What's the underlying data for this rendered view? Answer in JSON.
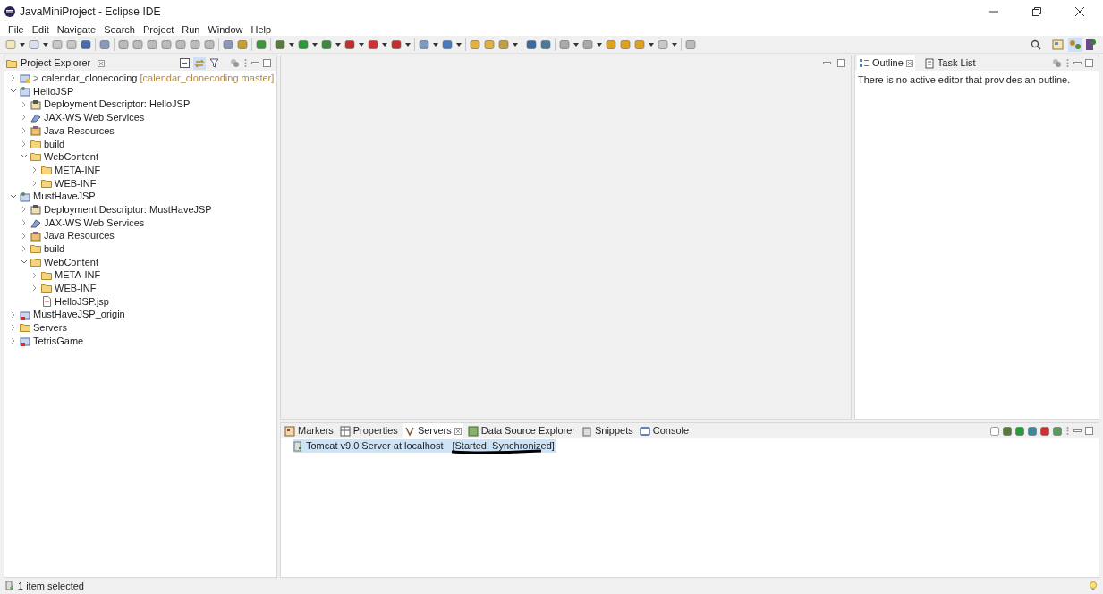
{
  "window": {
    "title": "JavaMiniProject - Eclipse IDE"
  },
  "menu": [
    "File",
    "Edit",
    "Navigate",
    "Search",
    "Project",
    "Run",
    "Window",
    "Help"
  ],
  "project_explorer": {
    "title": "Project Explorer",
    "items": [
      {
        "label": "calendar_clonecoding",
        "prefix": ">",
        "decoration": "[calendar_clonecoding master]",
        "kind": "git-project",
        "expanded": false
      },
      {
        "label": "HelloJSP",
        "kind": "web-project",
        "expanded": true,
        "children": [
          {
            "label": "Deployment Descriptor: HelloJSP",
            "kind": "descriptor",
            "expanded": false
          },
          {
            "label": "JAX-WS Web Services",
            "kind": "webservices",
            "expanded": false
          },
          {
            "label": "Java Resources",
            "kind": "resources",
            "expanded": false
          },
          {
            "label": "build",
            "kind": "folder",
            "expanded": false
          },
          {
            "label": "WebContent",
            "kind": "folder",
            "expanded": true,
            "children": [
              {
                "label": "META-INF",
                "kind": "folder",
                "expanded": false
              },
              {
                "label": "WEB-INF",
                "kind": "folder",
                "expanded": false
              }
            ]
          }
        ]
      },
      {
        "label": "MustHaveJSP",
        "kind": "web-project",
        "expanded": true,
        "children": [
          {
            "label": "Deployment Descriptor: MustHaveJSP",
            "kind": "descriptor",
            "expanded": false
          },
          {
            "label": "JAX-WS Web Services",
            "kind": "webservices",
            "expanded": false
          },
          {
            "label": "Java Resources",
            "kind": "resources",
            "expanded": false
          },
          {
            "label": "build",
            "kind": "folder",
            "expanded": false
          },
          {
            "label": "WebContent",
            "kind": "folder",
            "expanded": true,
            "children": [
              {
                "label": "META-INF",
                "kind": "folder",
                "expanded": false
              },
              {
                "label": "WEB-INF",
                "kind": "folder",
                "expanded": false
              },
              {
                "label": "HelloJSP.jsp",
                "kind": "file"
              }
            ]
          }
        ]
      },
      {
        "label": "MustHaveJSP_origin",
        "kind": "error-project",
        "expanded": false
      },
      {
        "label": "Servers",
        "kind": "folder",
        "expanded": false
      },
      {
        "label": "TetrisGame",
        "kind": "error-project",
        "expanded": false
      }
    ]
  },
  "outline_tabs": [
    {
      "label": "Outline",
      "selected": true
    },
    {
      "label": "Task List",
      "selected": false
    }
  ],
  "outline_message": "There is no active editor that provides an outline.",
  "bottom_tabs": [
    {
      "label": "Markers",
      "selected": false
    },
    {
      "label": "Properties",
      "selected": false
    },
    {
      "label": "Servers",
      "selected": true
    },
    {
      "label": "Data Source Explorer",
      "selected": false
    },
    {
      "label": "Snippets",
      "selected": false
    },
    {
      "label": "Console",
      "selected": false
    }
  ],
  "servers": [
    {
      "name": "Tomcat v9.0 Server at localhost",
      "state": "[Started, Synchronized]",
      "selected": true
    }
  ],
  "status_bar": {
    "text": "1 item selected"
  }
}
